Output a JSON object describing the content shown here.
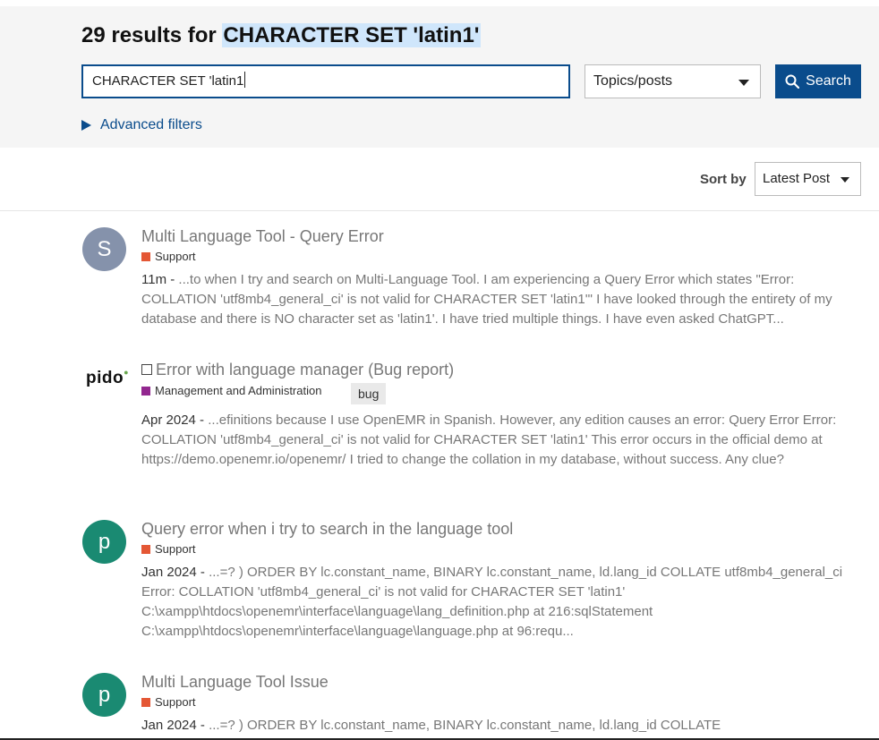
{
  "header": {
    "results_count_text": "29 results for",
    "query_text": "CHARACTER SET 'latin1'"
  },
  "search": {
    "input_value": "CHARACTER SET 'latin1",
    "type_selected": "Topics/posts",
    "button_label": "Search",
    "advanced_filters_label": "Advanced filters"
  },
  "sort": {
    "label": "Sort by",
    "selected": "Latest Post"
  },
  "results": [
    {
      "avatar_letter": "S",
      "avatar_color": "#8592ab",
      "title": "Multi Language Tool - Query Error",
      "category": "Support",
      "category_color": "#e45735",
      "date": "11m",
      "excerpt": "...to when I try and search on Multi-Language Tool. I am experiencing a Query Error which states \"Error: COLLATION 'utf8mb4_general_ci' is not valid for CHARACTER SET 'latin1'\" I have looked through the entirety of my database and there is NO character set as 'latin1'. I have tried multiple things. I have even asked ChatGPT..."
    },
    {
      "avatar_logo": "pido",
      "title": "Error with language manager (Bug report)",
      "category": "Management and Administration",
      "category_color": "#92278f",
      "tag": "bug",
      "date": "Apr 2024",
      "excerpt": "...efinitions because I use OpenEMR in Spanish. However, any edition causes an error: Query Error Error: COLLATION 'utf8mb4_general_ci' is not valid for CHARACTER SET 'latin1' This error occurs in the official demo at https://demo.openemr.io/openemr/ I tried to change the collation in my database, without success. Any clue?"
    },
    {
      "avatar_letter": "p",
      "avatar_color": "#1a8a72",
      "title": "Query error when i try to search in the language tool",
      "category": "Support",
      "category_color": "#e45735",
      "date": "Jan 2024",
      "excerpt": "...=? ) ORDER BY lc.constant_name, BINARY lc.constant_name, ld.lang_id COLLATE utf8mb4_general_ci Error: COLLATION 'utf8mb4_general_ci' is not valid for CHARACTER SET 'latin1' C:\\xampp\\htdocs\\openemr\\interface\\language\\lang_definition.php at 216:sqlStatement C:\\xampp\\htdocs\\openemr\\interface\\language\\language.php at 96:requ..."
    },
    {
      "avatar_letter": "p",
      "avatar_color": "#1a8a72",
      "title": "Multi Language Tool Issue",
      "category": "Support",
      "category_color": "#e45735",
      "date": "Jan 2024",
      "excerpt": "...=? ) ORDER BY lc.constant_name, BINARY lc.constant_name, ld.lang_id COLLATE"
    }
  ]
}
